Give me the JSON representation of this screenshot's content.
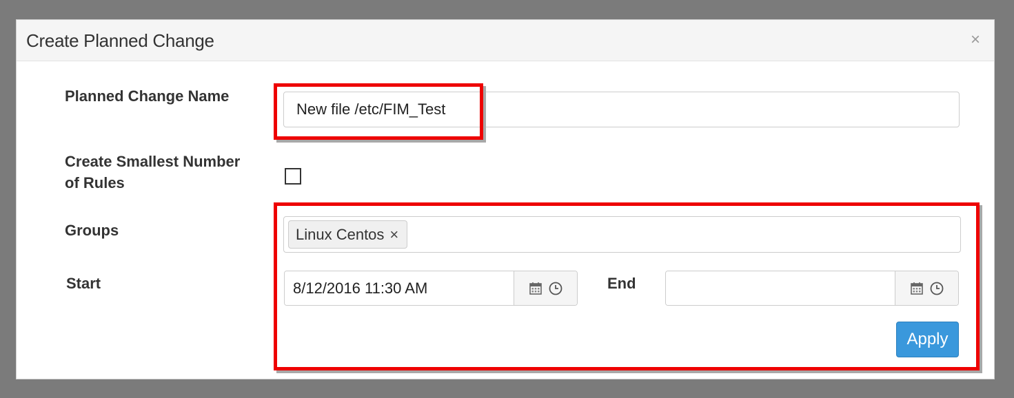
{
  "dialog": {
    "title": "Create Planned Change",
    "close_label": "×"
  },
  "form": {
    "name_label": "Planned Change Name",
    "name_value": "New file /etc/FIM_Test",
    "rules_label": "Create Smallest Number of Rules",
    "rules_checked": false,
    "groups_label": "Groups",
    "groups": [
      {
        "label": "Linux Centos",
        "remove": "×"
      }
    ],
    "start_label": "Start",
    "start_value": "8/12/2016 11:30 AM",
    "end_label": "End",
    "end_value": "",
    "apply_label": "Apply"
  },
  "icons": [
    "calendar-icon",
    "clock-icon",
    "close-icon",
    "tag-remove-icon"
  ],
  "colors": {
    "accent": "#3a98dc",
    "highlight": "#ee0000",
    "backdrop": "#7b7b7b"
  }
}
